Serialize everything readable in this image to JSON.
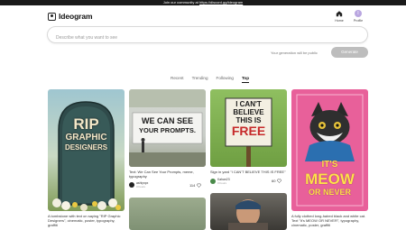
{
  "banner": {
    "prefix": "Join our community at",
    "link": "https://discord.gg/ideogram"
  },
  "header": {
    "brand": "Ideogram",
    "home_label": "Home",
    "profile_label": "Profile",
    "avatar_letter": "I"
  },
  "prompt": {
    "placeholder": "Describe what you want to see"
  },
  "generate": {
    "note": "Your generation will be public",
    "button": "Generate"
  },
  "tabs": [
    "Recent",
    "Trending",
    "Following",
    "Top"
  ],
  "active_tab": "Top",
  "cards": [
    {
      "image_text": [
        "RIP",
        "GRAPHIC",
        "DESIGNERS"
      ],
      "caption": "A tombstone with text on saying \"RIP Graphic Designers\", cinematic, poster, typography, graffiti",
      "user": "",
      "likes": ""
    },
    {
      "image_text": [
        "WE CAN SEE",
        "YOUR PROMPTS."
      ],
      "caption": "Text: We Can See Your Prompts, meme, typography",
      "user": "ashlynpx",
      "date": "3 hours",
      "likes": "114"
    },
    {
      "image_text": [
        "I CAN'T",
        "BELIEVE",
        "THIS IS",
        "FREE"
      ],
      "caption": "Sign in yard \"I CAN'T BELIEVE THIS IS FREE\"",
      "user": "Kahan23",
      "date": "3 hours",
      "likes": "60"
    },
    {
      "image_text": [
        "IT'S",
        "MEOW",
        "OR NEVER"
      ],
      "caption": "A fully clothed long-haired black and white cat. Text \"It's MEOW OR NEVER\", typography, cinematic, poster, graffiti",
      "user": "",
      "likes": ""
    }
  ],
  "colors": {
    "accent": "#111111",
    "button_disabled": "#bdbdbd",
    "cat_bg": "#e8609a",
    "sign_bg": "#7fb24a"
  }
}
